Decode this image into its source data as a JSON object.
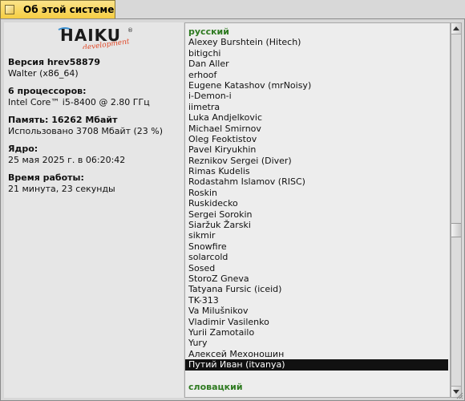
{
  "window": {
    "title": "Об этой системе"
  },
  "logo": {
    "main_text": "HAIKU",
    "sub_text": "development"
  },
  "system_info": [
    {
      "title": "Версия hrev58879",
      "value": "Walter (x86_64)"
    },
    {
      "title": "6 процессоров:",
      "value": "Intel Core™ i5-8400 @ 2.80 ГГц"
    },
    {
      "title": "Память: 16262 Мбайт",
      "value": "Использовано 3708 Мбайт  (23 %)"
    },
    {
      "title": "Ядро:",
      "value": "25 мая 2025 г. в 06:20:42"
    },
    {
      "title": "Время работы:",
      "value": "21 минута, 23 секунды"
    }
  ],
  "credits": {
    "section_header": "русский",
    "names": [
      "Alexey Burshtein (Hitech)",
      "bitigchi",
      "Dan Aller",
      "erhoof",
      "Eugene Katashov (mrNoisy)",
      "i-Demon-i",
      "iimetra",
      "Luka Andjelkovic",
      "Michael Smirnov",
      "Oleg Feoktistov",
      "Pavel Kiryukhin",
      "Reznikov Sergei (Diver)",
      "Rimas Kudelis",
      "Rodastahm Islamov (RISC)",
      "Roskin",
      "Ruskidecko",
      "Sergei Sorokin",
      "Siaržuk Žarski",
      "sikmir",
      "Snowfire",
      "solarcold",
      "Sosed",
      "StoroZ Gneva",
      "Tatyana Fursic (iceid)",
      "TK-313",
      "Va Milušnikov",
      "Vladimir Vasilenko",
      "Yurii Zamotailo",
      "Yury",
      "Алексей Мехоношин",
      "Путий Иван (itvanya)"
    ],
    "selected_index": 30,
    "next_section_header": "словацкий"
  },
  "scrollbar": {
    "position_fraction": 0.56
  },
  "colors": {
    "tab_yellow": "#f5cc3f",
    "section_header_green": "#2e7a20",
    "selection_bg": "#111111"
  }
}
